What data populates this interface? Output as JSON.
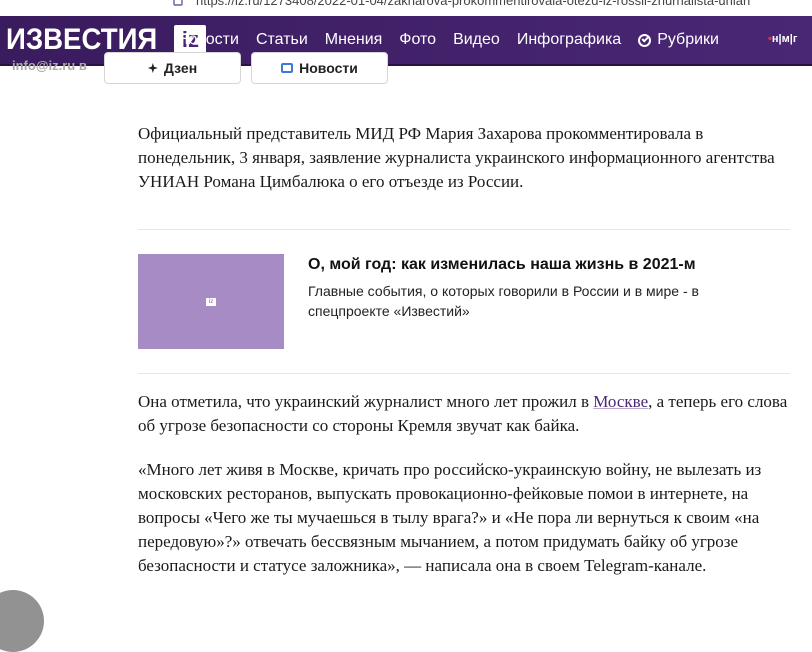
{
  "browser": {
    "url": "https://iz.ru/1273408/2022-01-04/zakharova-prokommentirovala-otezd-iz-rossii-zhurnalista-unian"
  },
  "header": {
    "logo_text": "ИЗВЕСТИЯ",
    "logo_badge": "iz",
    "nav": [
      "Новости",
      "Статьи",
      "Мнения",
      "Фото",
      "Видео",
      "Инфографика"
    ],
    "rubrics_label": "Рубрики",
    "media_links": [
      "н",
      "м",
      "г"
    ],
    "accent_color": "#4a2775"
  },
  "share": {
    "site_label": "info@iz.ru в",
    "dzen_label": "Дзен",
    "news_label": "Новости"
  },
  "article": {
    "p1": "Официальный представитель МИД РФ Мария Захарова прокомментировала в понедельник, 3 января, заявление журналиста украинского информационного агентства УНИАН Романа Цимбалюка о его отъезде из России.",
    "p2_before": "Она отметила, что украинский журналист много лет прожил в ",
    "p2_link": "Москве",
    "p2_after": ", а теперь его слова об угрозе безопасности со стороны Кремля звучат как байка.",
    "p3": "«Много лет живя в Москве, кричать про российско-украинскую войну, не вылезать из московских ресторанов, выпускать провокационно-фейковые помои в интернете, на вопросы «Чего же ты мучаешься в тылу врага?» и «Не пора ли вернуться к своим «на передовую»?» отвечать бессвязным мычанием, а потом придумать байку об угрозе безопасности и статусе заложника», — написала она в своем Telegram-канале."
  },
  "promo": {
    "thumb_logo": "iz",
    "title": "О, мой год: как изменилась наша жизнь в 2021-м",
    "description": "Главные события, о которых говорили в России и в мире - в спецпроекте «Известий»",
    "thumb_color": "#a78bc5"
  }
}
